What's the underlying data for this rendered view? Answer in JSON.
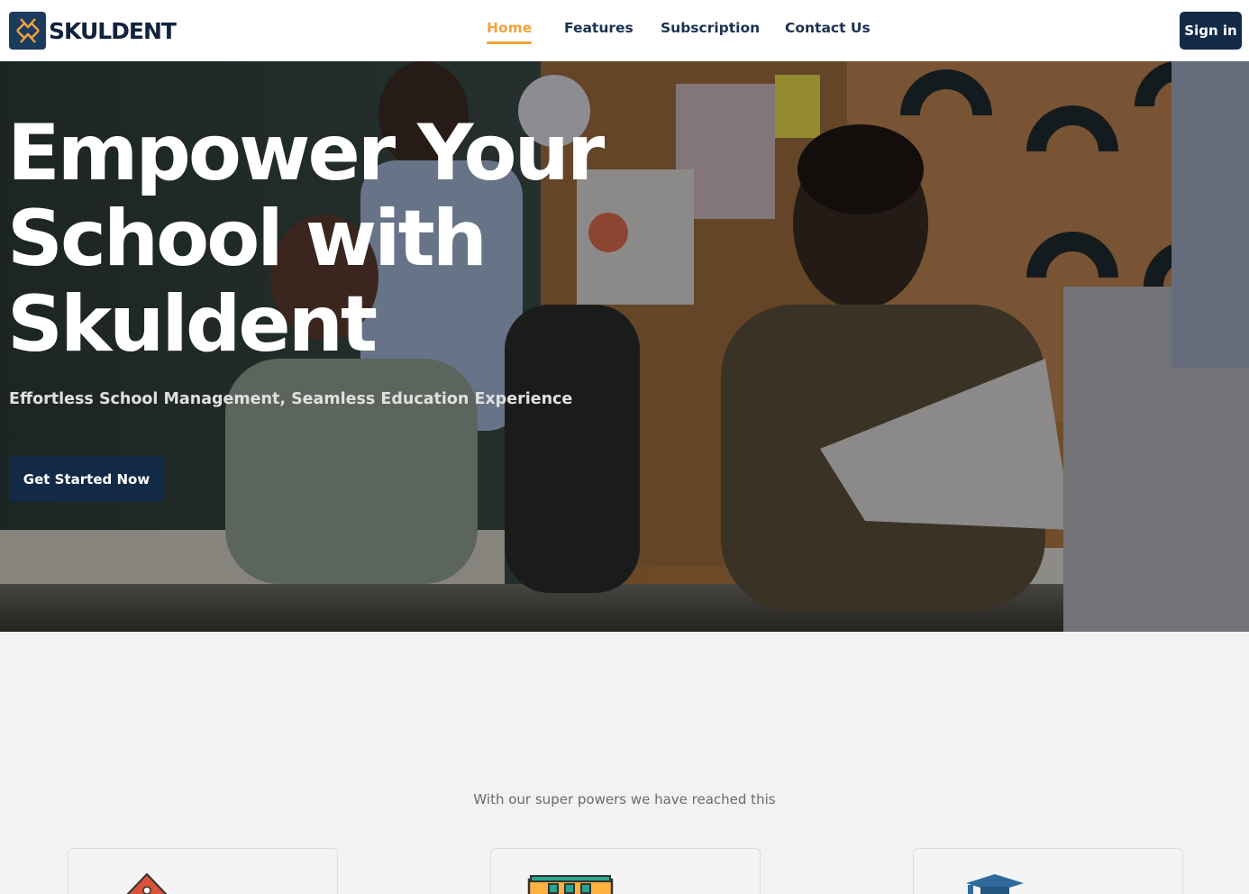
{
  "brand": {
    "name": "SKULDENT",
    "color_primary": "#132a46",
    "color_accent": "#f2a33a"
  },
  "nav": {
    "items": [
      {
        "label": "Home",
        "active": true
      },
      {
        "label": "Features",
        "active": false
      },
      {
        "label": "Subscription",
        "active": false
      },
      {
        "label": "Contact Us",
        "active": false
      }
    ],
    "signin_label": "Sign in"
  },
  "hero": {
    "title_line1": "Empower Your",
    "title_line2": "School with",
    "title_line3": "Skuldent",
    "subtitle": "Effortless School Management, Seamless Education Experience",
    "cta_label": "Get Started Now"
  },
  "stats": {
    "caption": "With our super powers we have reached this",
    "cards": [
      {
        "icon": "school-building-icon"
      },
      {
        "icon": "library-building-icon"
      },
      {
        "icon": "graduation-cap-icon"
      }
    ]
  }
}
